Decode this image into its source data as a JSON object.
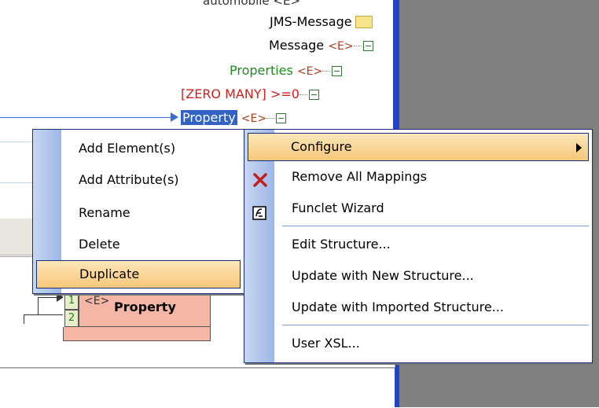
{
  "tree": {
    "partial_top_label": "automobile <E>",
    "jms_message": "JMS-Message",
    "message": "Message",
    "properties": "Properties",
    "zero_many": "[ZERO MANY]",
    "zero_many_suffix": ">=0",
    "property": "Property",
    "element_tag": "<E>"
  },
  "left_menu": {
    "items": [
      {
        "label": "Add Element(s)"
      },
      {
        "label": "Add Attribute(s)"
      },
      {
        "label": "Rename"
      },
      {
        "label": "Delete"
      },
      {
        "label": "Duplicate",
        "highlighted": true
      }
    ]
  },
  "right_menu": {
    "items": [
      {
        "label": "Configure",
        "highlighted": true,
        "submenu": true
      },
      {
        "label": "Remove All Mappings",
        "icon": "red-x-icon"
      },
      {
        "label": "Funclet Wizard",
        "icon": "funclet-icon"
      },
      {
        "label": "Edit Structure..."
      },
      {
        "label": "Update with New Structure..."
      },
      {
        "label": "Update with Imported Structure..."
      },
      {
        "label": "User XSL..."
      }
    ]
  },
  "property_box": {
    "row1_num": "1",
    "row2_num": "2",
    "tag": "<E>",
    "name": "Property"
  },
  "colors": {
    "accent_blue": "#1f44c8",
    "menu_highlight": "#f7c77a",
    "selection": "#3162c4",
    "properties_green": "#1e8a1e",
    "zero_many_red": "#d0201a"
  }
}
